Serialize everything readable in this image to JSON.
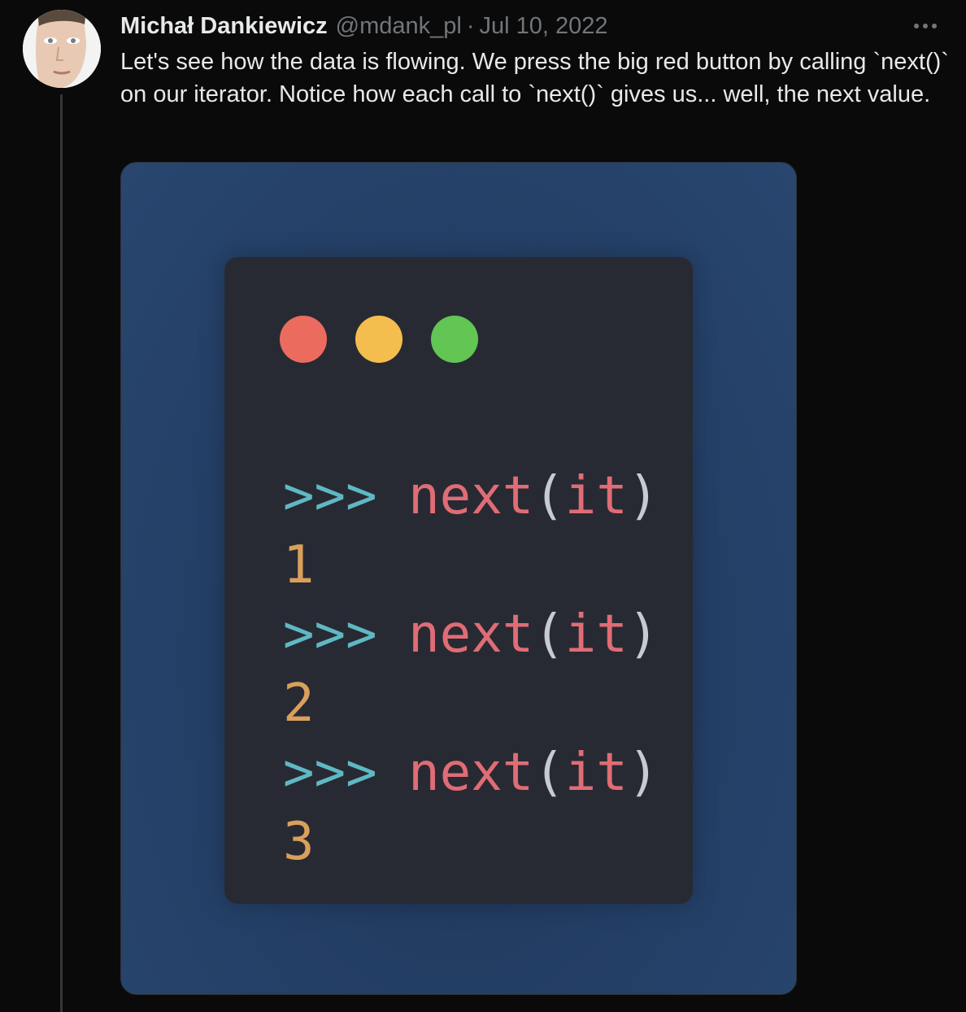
{
  "tweet": {
    "author": {
      "display_name": "Michał Dankiewicz",
      "handle": "@mdank_pl"
    },
    "separator": "·",
    "date": "Jul 10, 2022",
    "text": "Let's see how the data is flowing. We press the big red button by calling `next()` on our iterator. Notice how each call to `next()` gives us... well, the next value.",
    "more_icon": "more-horizontal-icon"
  },
  "media": {
    "window_dots": [
      {
        "name": "red-dot",
        "color": "#ec6b5f"
      },
      {
        "name": "yellow-dot",
        "color": "#f4be4f"
      },
      {
        "name": "green-dot",
        "color": "#62c554"
      }
    ],
    "code_lines": [
      {
        "type": "input",
        "prompt": ">>>",
        "fn": "next",
        "open": "(",
        "arg": "it",
        "close": ")"
      },
      {
        "type": "output",
        "value": "1"
      },
      {
        "type": "input",
        "prompt": ">>>",
        "fn": "next",
        "open": "(",
        "arg": "it",
        "close": ")"
      },
      {
        "type": "output",
        "value": "2"
      },
      {
        "type": "input",
        "prompt": ">>>",
        "fn": "next",
        "open": "(",
        "arg": "it",
        "close": ")"
      },
      {
        "type": "output",
        "value": "3"
      }
    ],
    "colors": {
      "prompt": "#5fb8c4",
      "function": "#e06c75",
      "paren": "#c7cbd1",
      "number": "#d9a05b",
      "window_bg": "#282a33"
    }
  }
}
